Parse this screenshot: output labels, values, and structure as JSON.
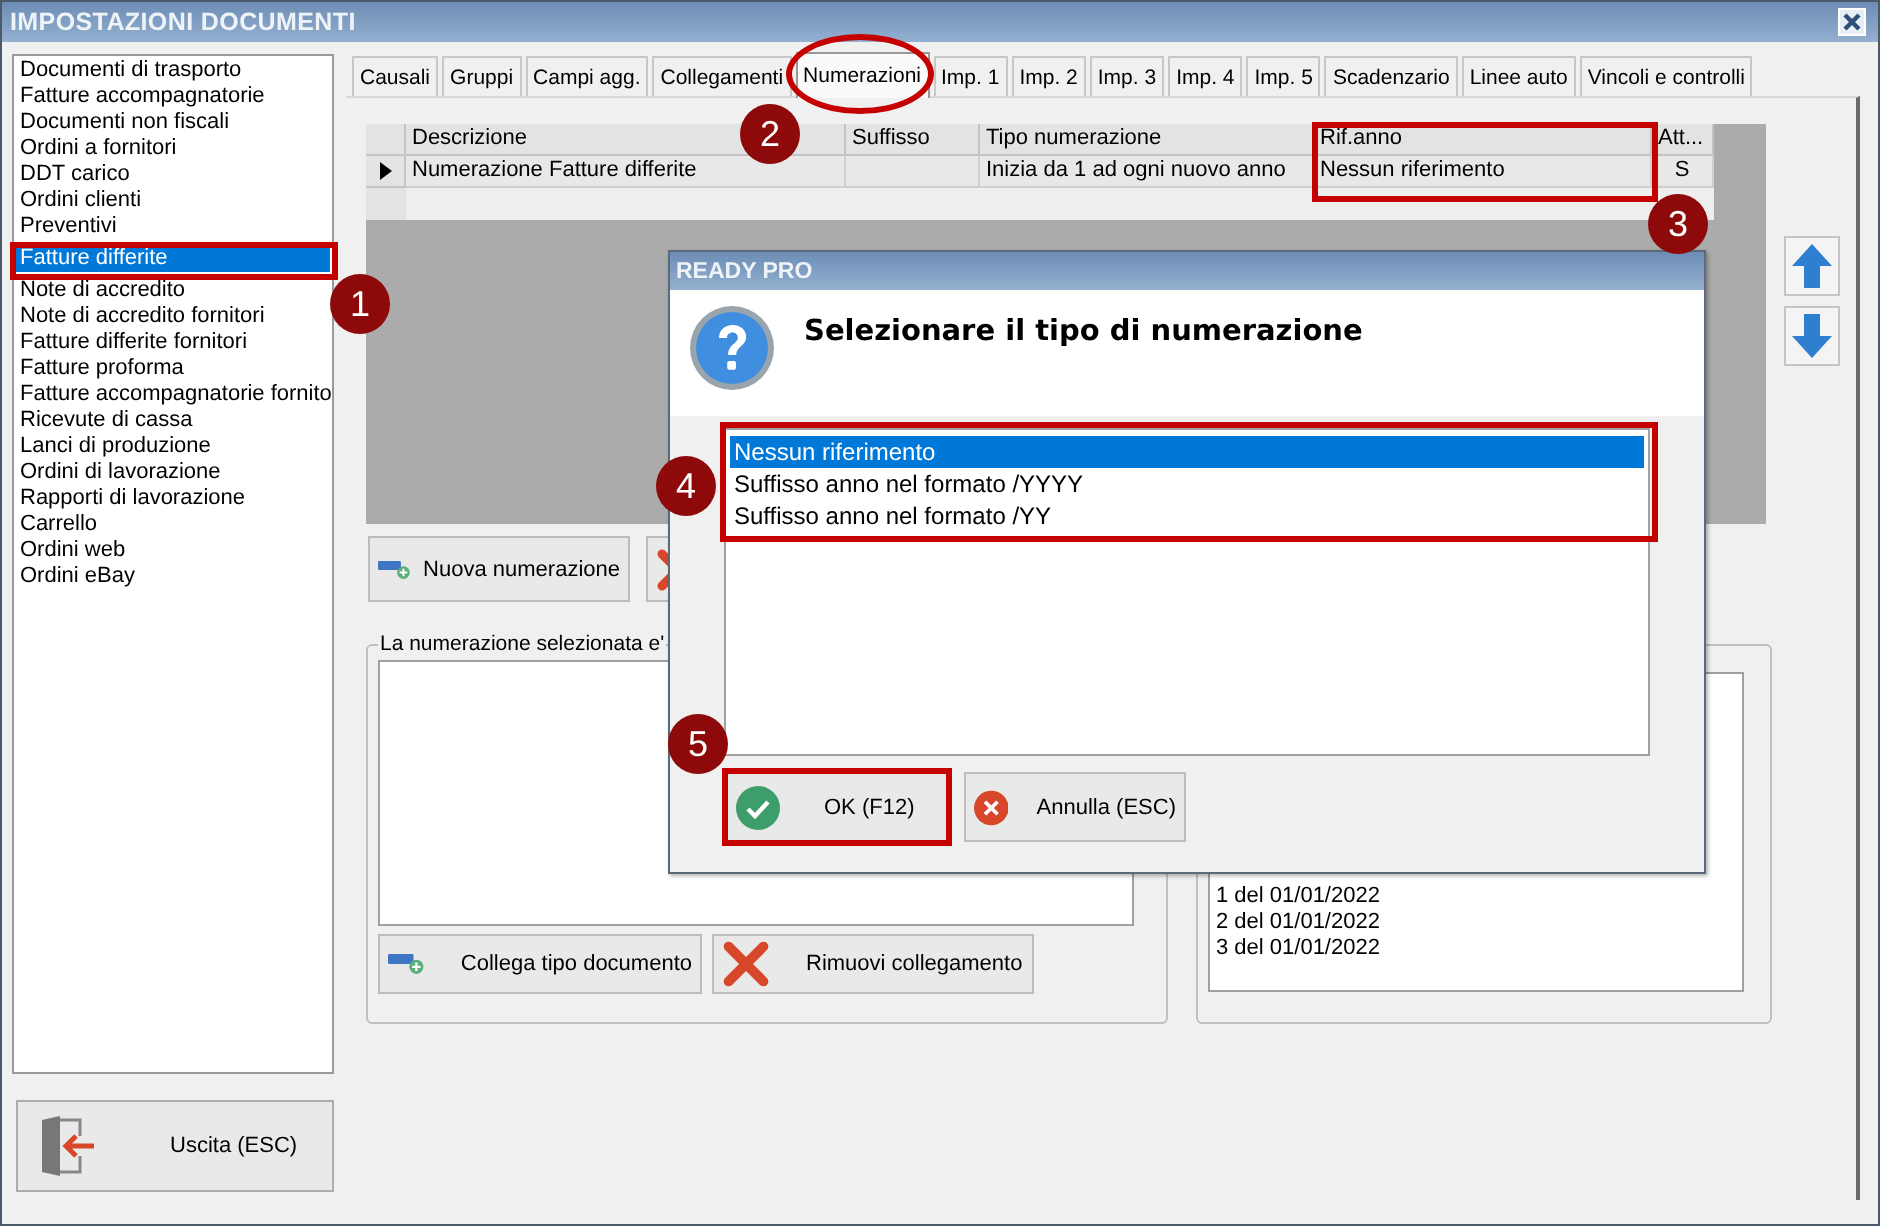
{
  "window": {
    "title": "IMPOSTAZIONI DOCUMENTI"
  },
  "document_types": {
    "items": [
      {
        "label": "Documenti di trasporto",
        "selected": false
      },
      {
        "label": "Fatture accompagnatorie",
        "selected": false
      },
      {
        "label": "Documenti non fiscali",
        "selected": false
      },
      {
        "label": "Ordini a fornitori",
        "selected": false
      },
      {
        "label": "DDT carico",
        "selected": false
      },
      {
        "label": "Ordini clienti",
        "selected": false
      },
      {
        "label": "Preventivi",
        "selected": false
      },
      {
        "label": "Fatture differite",
        "selected": true
      },
      {
        "label": "Note di accredito",
        "selected": false
      },
      {
        "label": "Note di accredito fornitori",
        "selected": false
      },
      {
        "label": "Fatture differite fornitori",
        "selected": false
      },
      {
        "label": "Fatture proforma",
        "selected": false
      },
      {
        "label": "Fatture accompagnatorie fornito",
        "selected": false
      },
      {
        "label": "Ricevute di cassa",
        "selected": false
      },
      {
        "label": "Lanci di produzione",
        "selected": false
      },
      {
        "label": "Ordini di lavorazione",
        "selected": false
      },
      {
        "label": "Rapporti di lavorazione",
        "selected": false
      },
      {
        "label": "Carrello",
        "selected": false
      },
      {
        "label": "Ordini web",
        "selected": false
      },
      {
        "label": "Ordini eBay",
        "selected": false
      }
    ]
  },
  "exit_button": "Uscita (ESC)",
  "tabs": [
    {
      "label": "Causali",
      "selected": false
    },
    {
      "label": "Gruppi",
      "selected": false
    },
    {
      "label": "Campi agg.",
      "selected": false
    },
    {
      "label": "Collegamenti",
      "selected": false
    },
    {
      "label": "Numerazioni",
      "selected": true
    },
    {
      "label": "Imp. 1",
      "selected": false
    },
    {
      "label": "Imp. 2",
      "selected": false
    },
    {
      "label": "Imp. 3",
      "selected": false
    },
    {
      "label": "Imp. 4",
      "selected": false
    },
    {
      "label": "Imp. 5",
      "selected": false
    },
    {
      "label": "Scadenzario",
      "selected": false
    },
    {
      "label": "Linee auto",
      "selected": false
    },
    {
      "label": "Vincoli e controlli",
      "selected": false
    }
  ],
  "numbering_table": {
    "columns": [
      "Descrizione",
      "Suffisso",
      "Tipo numerazione",
      "Rif.anno",
      "Att..."
    ],
    "rows": [
      {
        "cells": [
          "Numerazione Fatture differite",
          "",
          "Inizia da 1 ad ogni nuovo anno",
          "Nessun riferimento",
          "S"
        ],
        "current": true
      }
    ]
  },
  "new_numbering_button": "Nuova numerazione",
  "linked_group": {
    "title": "La numerazione selezionata e'",
    "buttons": [
      "Collega tipo documento",
      "Rimuovi collegamento"
    ]
  },
  "numbers_list": {
    "items": [
      "1 del 01/01/2022",
      "2 del 01/01/2022",
      "3 del 01/01/2022"
    ]
  },
  "dialog": {
    "title": "READY PRO",
    "prompt": "Selezionare il tipo di numerazione",
    "options": [
      {
        "label": "Nessun riferimento",
        "selected": true
      },
      {
        "label": "Suffisso anno nel formato /YYYY",
        "selected": false
      },
      {
        "label": "Suffisso anno nel formato /YY",
        "selected": false
      }
    ],
    "buttons": [
      {
        "label": "OK (F12)",
        "kind": "confirm"
      },
      {
        "label": "Annulla (ESC)",
        "kind": "cancel"
      }
    ]
  },
  "callouts": [
    "1",
    "2",
    "3",
    "4",
    "5"
  ]
}
